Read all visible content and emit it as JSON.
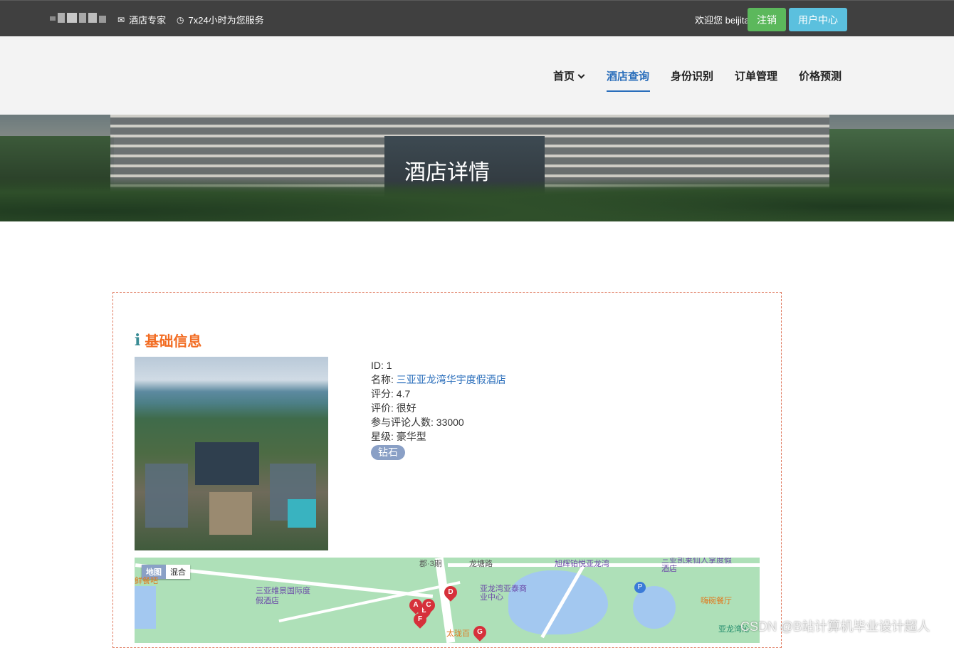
{
  "topbar": {
    "email_label": "酒店专家",
    "hours_label": "7x24小时为您服务",
    "welcome_text": "欢迎您 beijita",
    "logout_label": "注销",
    "user_center_label": "用户中心"
  },
  "nav": {
    "items": [
      {
        "label": "首页"
      },
      {
        "label": "酒店查询"
      },
      {
        "label": "身份识别"
      },
      {
        "label": "订单管理"
      },
      {
        "label": "价格预测"
      }
    ]
  },
  "banner": {
    "title": "酒店详情"
  },
  "section": {
    "title": "基础信息"
  },
  "hotel": {
    "id_label": "ID:",
    "id_value": "1",
    "name_label": "名称:",
    "name_value": "三亚亚龙湾华宇度假酒店",
    "rating_label": "评分:",
    "rating_value": "4.7",
    "review_label": "评价:",
    "review_value": "很好",
    "count_label": "参与评论人数:",
    "count_value": "33000",
    "star_label": "星级:",
    "star_value": "豪华型",
    "badge": "钻石"
  },
  "map": {
    "toggle": [
      "地图",
      "混合"
    ],
    "pois": [
      "郡·3期",
      "龙塘路",
      "旭辉铂悦亚龙湾",
      "三亚凯莱仙人掌度假酒店",
      "三亚维景国际度假酒店",
      "亚龙湾亚泰商业中心",
      "嗨碗餐厅",
      "太珑百",
      "亚龙湾沁",
      "鲜餐吧"
    ],
    "pins": [
      "A",
      "B",
      "C",
      "D",
      "F",
      "G"
    ]
  },
  "watermark": "CSDN @B站计算机毕业设计超人",
  "colors": {
    "topbar_bg": "#404040",
    "accent_blue": "#2a6ebb",
    "orange_title": "#f26b21",
    "logout_green": "#5cb85c",
    "user_center_cyan": "#5bc0de",
    "badge_bg": "#8aa0c6",
    "card_border": "#e07a5f"
  }
}
